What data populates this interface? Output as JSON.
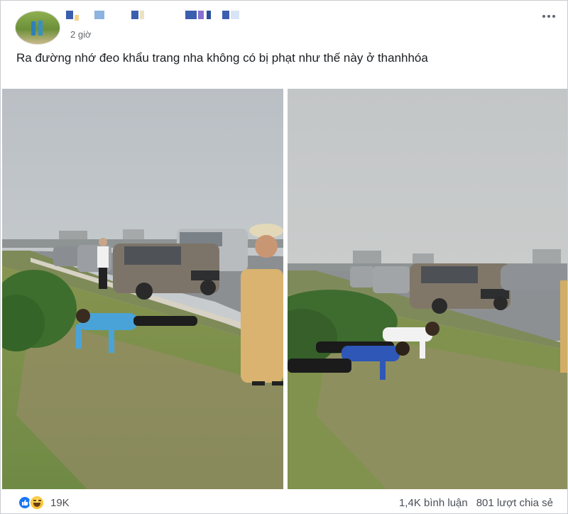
{
  "post": {
    "time": "2 giờ",
    "caption": "Ra đường nhớ đeo khẩu trang nha không có bị phạt như thế này ở thanhhóa"
  },
  "footer": {
    "reaction_count": "19K",
    "comments": "1,4K bình luận",
    "shares": "801 lượt chia sẻ"
  },
  "colors": {
    "like_blue": "#1877f2",
    "haha_yellow": "#f7b928",
    "meta_gray": "#65676b"
  },
  "icons": {
    "reactions": [
      "like-icon",
      "haha-icon"
    ],
    "menu": "more-options-icon"
  }
}
